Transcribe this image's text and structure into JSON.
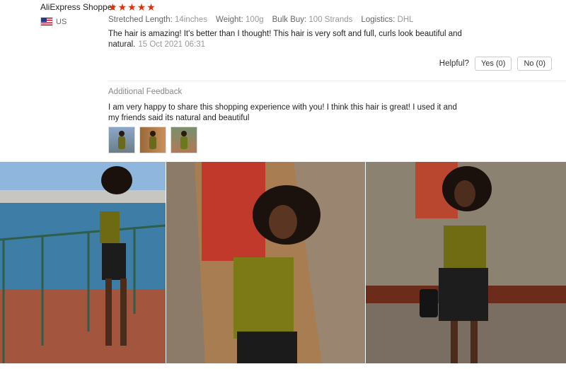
{
  "reviewer": {
    "name": "AliExpress Shopper",
    "country": "US",
    "rating": 5
  },
  "properties": [
    {
      "key": "Stretched Length:",
      "value": "14inches"
    },
    {
      "key": "Weight:",
      "value": "100g"
    },
    {
      "key": "Bulk Buy:",
      "value": "100 Strands"
    },
    {
      "key": "Logistics:",
      "value": "DHL"
    }
  ],
  "review": {
    "text": "The hair is amazing! It's better than I thought! This hair is very soft and full, curls look beautiful and natural.",
    "date": "15 Oct 2021 06:31"
  },
  "helpful": {
    "label": "Helpful?",
    "yes": "Yes (0)",
    "no": "No (0)"
  },
  "additional_feedback": {
    "title": "Additional Feedback",
    "text": "I am very happy to share this shopping experience with you! I think this hair is great! I used it and my friends said its natural and beautiful"
  },
  "colors": {
    "star": "#e62e04",
    "muted": "#999999"
  }
}
